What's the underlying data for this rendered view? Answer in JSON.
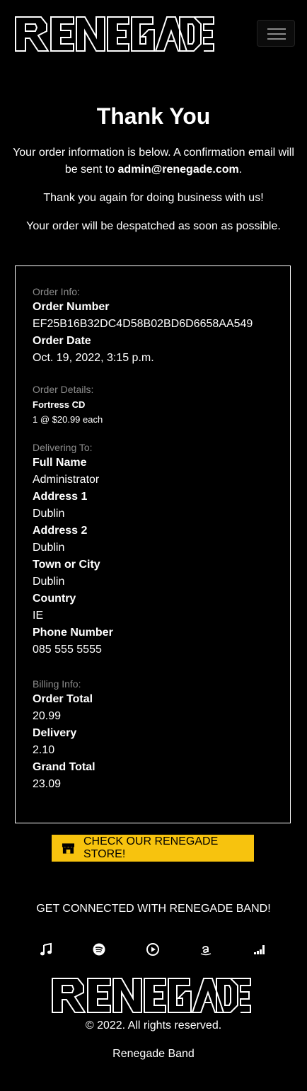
{
  "brand": {
    "logo_text": "RENEGADE"
  },
  "nav": {
    "toggle_icon": "hamburger-menu-icon"
  },
  "page": {
    "title": "Thank You",
    "intro_prefix": "Your order information is below. A confirmation email will be sent to ",
    "email": "admin@renegade.com",
    "intro_suffix": ".",
    "thanks": "Thank you again for doing business with us!",
    "despatch": "Your order will be despatched as soon as possible."
  },
  "order": {
    "info_label": "Order Info:",
    "number_key": "Order Number",
    "number": "EF25B16B32DC4D58B02BD6D6658AA549",
    "date_key": "Order Date",
    "date": "Oct. 19, 2022, 3:15 p.m.",
    "details_label": "Order Details:",
    "items": [
      {
        "name": "Fortress CD",
        "quantity_text": "1 @ $20.99 each"
      }
    ],
    "delivering_label": "Delivering To:",
    "full_name_key": "Full Name",
    "full_name": "Administrator",
    "address1_key": "Address 1",
    "address1": "Dublin",
    "address2_key": "Address 2",
    "address2": "Dublin",
    "town_key": "Town or City",
    "town": "Dublin",
    "country_key": "Country",
    "country": "IE",
    "phone_key": "Phone Number",
    "phone": "085 555 5555",
    "billing_label": "Billing Info:",
    "total_key": "Order Total",
    "total": "20.99",
    "delivery_key": "Delivery",
    "delivery": "2.10",
    "grand_total_key": "Grand Total",
    "grand_total": "23.09"
  },
  "store_button": {
    "label": "CHECK OUR RENEGADE STORE!",
    "icon": "store-icon"
  },
  "footer": {
    "connect": "GET CONNECTED WITH RENEGADE BAND!",
    "social_icons": [
      "music-note-icon",
      "spotify-icon",
      "play-circle-icon",
      "amazon-icon",
      "deezer-icon"
    ],
    "copyright": "© 2022. All rights reserved.",
    "band": "Renegade Band"
  },
  "colors": {
    "background": "#000000",
    "accent": "#f7c30e",
    "muted": "#8c8c8c"
  }
}
